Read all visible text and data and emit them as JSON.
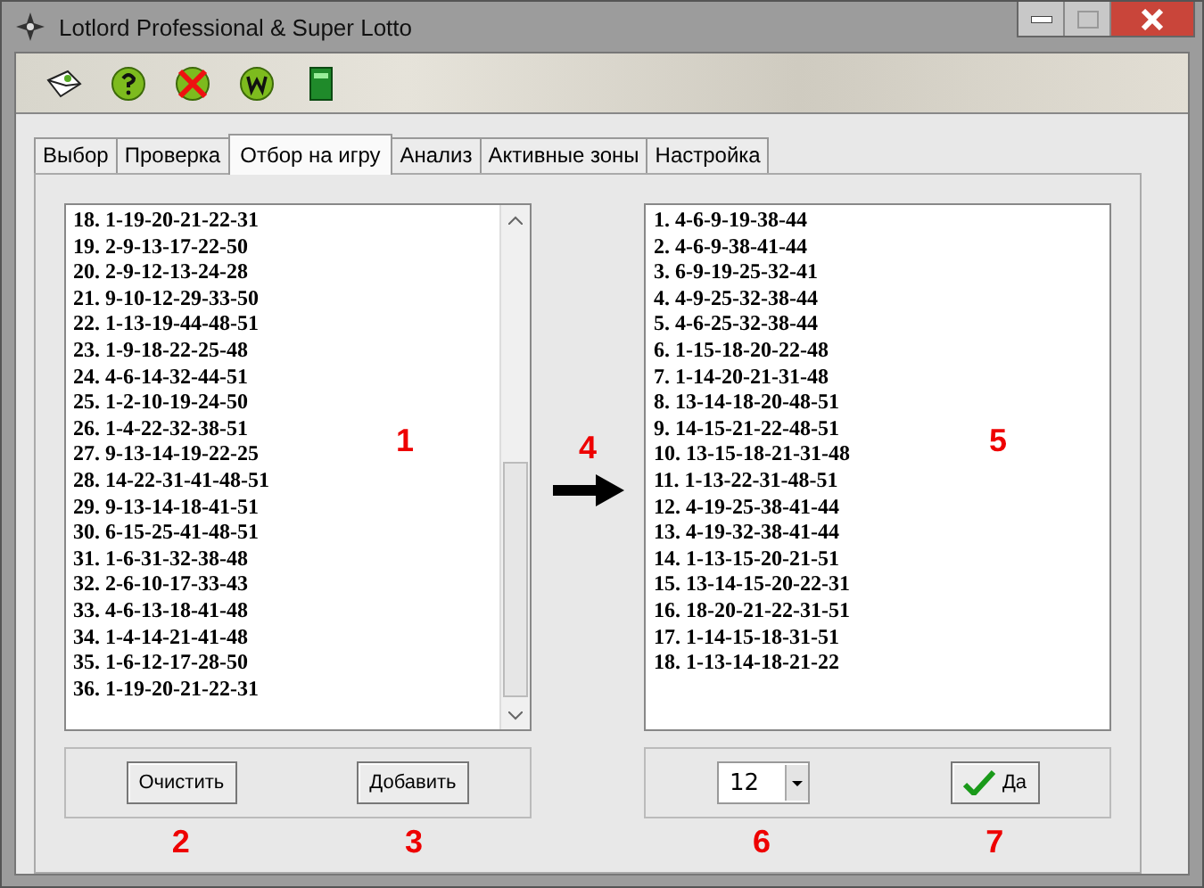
{
  "window": {
    "title": "Lotlord Professional & Super Lotto"
  },
  "toolbar": {
    "buttons": [
      {
        "kind": "mail"
      },
      {
        "kind": "help"
      },
      {
        "kind": "cancel"
      },
      {
        "kind": "web"
      },
      {
        "kind": "book"
      }
    ]
  },
  "tabs": [
    {
      "label": "Выбор",
      "selected": false
    },
    {
      "label": "Проверка",
      "selected": false
    },
    {
      "label": "Отбор на игру",
      "selected": true
    },
    {
      "label": "Анализ",
      "selected": false
    },
    {
      "label": "Активные зоны",
      "selected": false
    },
    {
      "label": "Настройка",
      "selected": false
    }
  ],
  "source_list": {
    "items": [
      "18. 1-19-20-21-22-31",
      "19. 2-9-13-17-22-50",
      "20. 2-9-12-13-24-28",
      "21. 9-10-12-29-33-50",
      "22. 1-13-19-44-48-51",
      "23. 1-9-18-22-25-48",
      "24. 4-6-14-32-44-51",
      "25. 1-2-10-19-24-50",
      "26. 1-4-22-32-38-51",
      "27. 9-13-14-19-22-25",
      "28. 14-22-31-41-48-51",
      "29. 9-13-14-18-41-51",
      "30. 6-15-25-41-48-51",
      "31. 1-6-31-32-38-48",
      "32. 2-6-10-17-33-43",
      "33. 4-6-13-18-41-48",
      "34. 1-4-14-21-41-48",
      "35. 1-6-12-17-28-50",
      "36. 1-19-20-21-22-31"
    ],
    "annotation": "1"
  },
  "arrow_annotation": "4",
  "result_list": {
    "items": [
      "1. 4-6-9-19-38-44",
      "2. 4-6-9-38-41-44",
      "3. 6-9-19-25-32-41",
      "4. 4-9-25-32-38-44",
      "5. 4-6-25-32-38-44",
      "6. 1-15-18-20-22-48",
      "7. 1-14-20-21-31-48",
      "8. 13-14-18-20-48-51",
      "9. 14-15-21-22-48-51",
      "10. 13-15-18-21-31-48",
      "11. 1-13-22-31-48-51",
      "12. 4-19-25-38-41-44",
      "13. 4-19-32-38-41-44",
      "14. 1-13-15-20-21-51",
      "15. 13-14-15-20-22-31",
      "16. 18-20-21-22-31-51",
      "17. 1-14-15-18-31-51",
      "18. 1-13-14-18-21-22"
    ],
    "annotation": "5"
  },
  "left_buttons": [
    {
      "label": "Очистить",
      "annotation": "2"
    },
    {
      "label": "Добавить",
      "annotation": "3"
    }
  ],
  "count_select": {
    "value": "12",
    "annotation": "6"
  },
  "ok_button": {
    "label": "Да",
    "annotation": "7"
  }
}
